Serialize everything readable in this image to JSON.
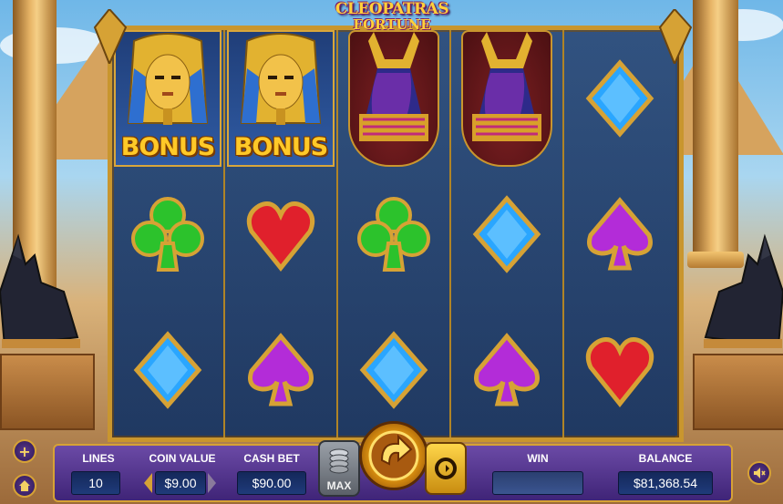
{
  "logo": {
    "line1": "CLEOPATRAS",
    "line2": "FORTUNE"
  },
  "reels": {
    "columns": [
      [
        "bonus-pharaoh",
        "club-green",
        "diamond-blue"
      ],
      [
        "bonus-pharaoh",
        "heart-red",
        "spade-purple"
      ],
      [
        "anubis",
        "club-green",
        "diamond-blue"
      ],
      [
        "anubis",
        "diamond-blue",
        "spade-purple"
      ],
      [
        "diamond-blue",
        "spade-purple",
        "heart-red"
      ]
    ],
    "bonus_label": "BONUS"
  },
  "bar": {
    "lines_label": "LINES",
    "lines_value": "10",
    "coin_value_label": "COIN VALUE",
    "coin_value": "$9.00",
    "cash_bet_label": "CASH BET",
    "cash_bet": "$90.00",
    "max_label": "MAX",
    "win_label": "WIN",
    "win_value": "",
    "balance_label": "BALANCE",
    "balance_value": "$81,368.54"
  },
  "side": {
    "plus_label": "+"
  },
  "colors": {
    "gold": "#d6a235",
    "purple": "#4b2c86",
    "panel_blue": "#1f3b7a"
  }
}
